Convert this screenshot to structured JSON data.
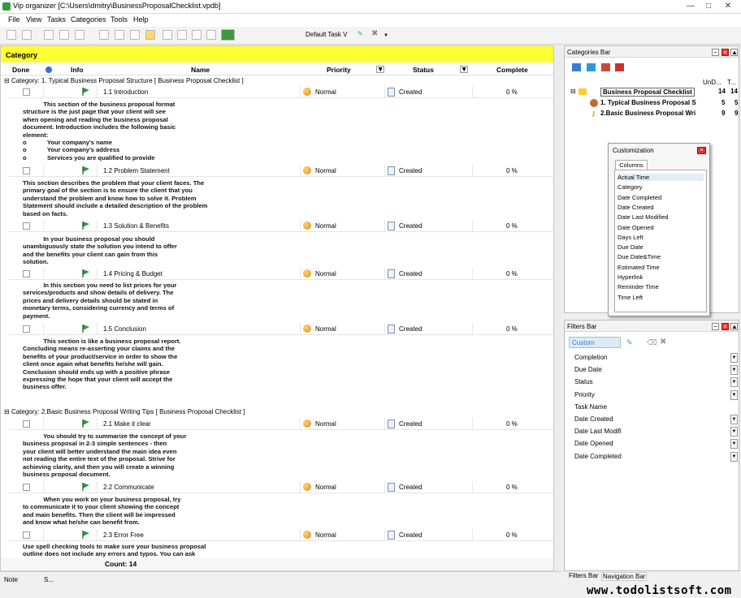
{
  "window": {
    "title": "Vip organizer [C:\\Users\\dmitry\\BusinessProposalChecklist.vpdb]"
  },
  "menu": [
    "File",
    "View",
    "Tasks",
    "Categories",
    "Tools",
    "Help"
  ],
  "toolbar": {
    "view_select": "Default Task V"
  },
  "main": {
    "category_bar": "Category",
    "columns": {
      "done": "Done",
      "info": "Info",
      "name": "Name",
      "priority": "Priority",
      "status": "Status",
      "complete": "Complete"
    },
    "groups": [
      {
        "label": "Category: 1. Typical Business Proposal Structure   [ Business Proposal Checklist ]"
      },
      {
        "label": "Category: 2.Basic Business Proposal Writing Tips   [ Business Proposal Checklist ]"
      }
    ],
    "tasks": [
      {
        "name": "1.1 Introduction",
        "priority": "Normal",
        "status": "Created",
        "complete": "0 %",
        "note": "            This section of the business proposal format\nstructure is the just page that your client will see\nwhen opening and reading the business proposal\ndocument. Introduction includes the following basic\nelement:\no            Your company's name\no            Your company's address\no            Services you are qualified to provide"
      },
      {
        "name": "1.2 Problem Statement",
        "priority": "Normal",
        "status": "Created",
        "complete": "0 %",
        "note": "This section describes the problem that your client faces. The\nprimary goal of the section is to ensure the client that you\nunderstand the problem and know how to solve it. Problem\nStatement should include a detailed description of the problem\nbased on facts."
      },
      {
        "name": "1.3 Solution & Benefits",
        "priority": "Normal",
        "status": "Created",
        "complete": "0 %",
        "note": "            In your business proposal you should\nunambiguously state the solution you intend to offer\nand the benefits your client can gain from this\nsolution."
      },
      {
        "name": "1.4 Pricing & Budget",
        "priority": "Normal",
        "status": "Created",
        "complete": "0 %",
        "note": "            In this section you need to list prices for your\nservices/products and show details of delivery. The\nprices and delivery details should be stated in\nmonetary terms, considering currency and terms of\npayment."
      },
      {
        "name": "1.5 Conclusion",
        "priority": "Normal",
        "status": "Created",
        "complete": "0 %",
        "note": "            This section is like a business proposal report.\nConcluding means re-asserting your claims and the\nbenefits of your product/service in order to show the\nclient once again what benefits he/she will gain.\nConclusion should ends up with a positive phrase\nexpressing the hope that your client will accept the\nbusiness offer."
      },
      {
        "name": "2.1 Make it clear",
        "priority": "Normal",
        "status": "Created",
        "complete": "0 %",
        "note": "            You should try to summarize the concept of your\nbusiness proposal in 2-3 simple sentences - then\nyour client will better understand the main idea even\nnot reading the entire text of the proposal. Strive for\nachieving clarity, and then you will create a winning\nbusiness proposal document."
      },
      {
        "name": "2.2 Communicate",
        "priority": "Normal",
        "status": "Created",
        "complete": "0 %",
        "note": "            When you work on your business proposal, try\nto communicate it to your client showing the concept\nand main benefits. Then the client will be impressed\nand know what he/she can benefit from."
      },
      {
        "name": "2.3 Error Free",
        "priority": "Normal",
        "status": "Created",
        "complete": "0 %",
        "note": "Use spell checking tools to make sure your business proposal\noutline does not include any errors and typos. You can ask"
      }
    ],
    "count": "Count: 14"
  },
  "categories_bar": {
    "title": "Categories Bar",
    "col1": "UnD...",
    "col2": "T...",
    "items": [
      {
        "label": "Business Proposal Checklist",
        "a": "14",
        "b": "14"
      },
      {
        "label": "1. Typical Business Proposal S",
        "a": "5",
        "b": "5"
      },
      {
        "label": "2.Basic Business Proposal Wri",
        "a": "9",
        "b": "9"
      }
    ]
  },
  "customization": {
    "title": "Customization",
    "tab": "Columns",
    "items": [
      "Actual Time",
      "Category",
      "Date Completed",
      "Date Created",
      "Date Last Modified",
      "Date Opened",
      "Days Left",
      "Due Date",
      "Due Date&Time",
      "Estimated Time",
      "Hyperlink",
      "Reminder Time",
      "Time Left"
    ]
  },
  "filters_bar": {
    "title": "Filters Bar",
    "preset": "Custom",
    "rows": [
      "Completion",
      "Due Date",
      "Status",
      "Priority",
      "Task Name",
      "Date Created",
      "Date Last Modifi",
      "Date Opened",
      "Date Completed"
    ]
  },
  "bottom_tabs": [
    "Filters Bar",
    "Navigation Bar"
  ],
  "statusbar": {
    "note": "Note",
    "s": "S..."
  },
  "watermark": "www.todolistsoft.com"
}
